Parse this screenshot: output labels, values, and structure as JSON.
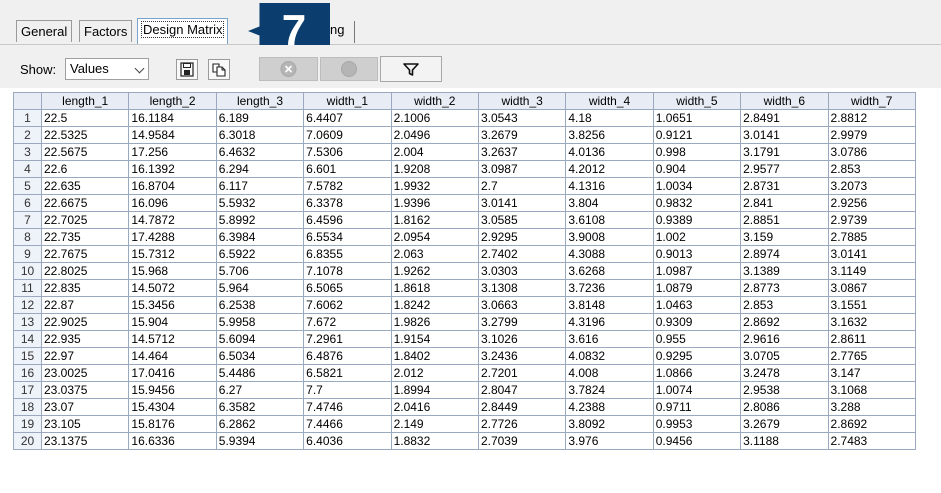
{
  "tabs": [
    {
      "label": "General",
      "active": false
    },
    {
      "label": "Factors",
      "active": false
    },
    {
      "label": "Design Matrix",
      "active": true
    }
  ],
  "tab_partial_text": "ng",
  "callout": {
    "number": "7",
    "color": "#0b3d6e"
  },
  "toolbar": {
    "show_label": "Show:",
    "show_value": "Values",
    "icons": [
      "save-icon",
      "copy-icon",
      "cancel-icon",
      "circle-icon",
      "filter-icon"
    ]
  },
  "grid": {
    "columns": [
      "length_1",
      "length_2",
      "length_3",
      "width_1",
      "width_2",
      "width_3",
      "width_4",
      "width_5",
      "width_6",
      "width_7"
    ],
    "rows": [
      [
        "1",
        "22.5",
        "16.1184",
        "6.189",
        "6.4407",
        "2.1006",
        "3.0543",
        "4.18",
        "1.0651",
        "2.8491",
        "2.8812"
      ],
      [
        "2",
        "22.5325",
        "14.9584",
        "6.3018",
        "7.0609",
        "2.0496",
        "3.2679",
        "3.8256",
        "0.9121",
        "3.0141",
        "2.9979"
      ],
      [
        "3",
        "22.5675",
        "17.256",
        "6.4632",
        "7.5306",
        "2.004",
        "3.2637",
        "4.0136",
        "0.998",
        "3.1791",
        "3.0786"
      ],
      [
        "4",
        "22.6",
        "16.1392",
        "6.294",
        "6.601",
        "1.9208",
        "3.0987",
        "4.2012",
        "0.904",
        "2.9577",
        "2.853"
      ],
      [
        "5",
        "22.635",
        "16.8704",
        "6.117",
        "7.5782",
        "1.9932",
        "2.7",
        "4.1316",
        "1.0034",
        "2.8731",
        "3.2073"
      ],
      [
        "6",
        "22.6675",
        "16.096",
        "5.5932",
        "6.3378",
        "1.9396",
        "3.0141",
        "3.804",
        "0.9832",
        "2.841",
        "2.9256"
      ],
      [
        "7",
        "22.7025",
        "14.7872",
        "5.8992",
        "6.4596",
        "1.8162",
        "3.0585",
        "3.6108",
        "0.9389",
        "2.8851",
        "2.9739"
      ],
      [
        "8",
        "22.735",
        "17.4288",
        "6.3984",
        "6.5534",
        "2.0954",
        "2.9295",
        "3.9008",
        "1.002",
        "3.159",
        "2.7885"
      ],
      [
        "9",
        "22.7675",
        "15.7312",
        "6.5922",
        "6.8355",
        "2.063",
        "2.7402",
        "4.3088",
        "0.9013",
        "2.8974",
        "3.0141"
      ],
      [
        "10",
        "22.8025",
        "15.968",
        "5.706",
        "7.1078",
        "1.9262",
        "3.0303",
        "3.6268",
        "1.0987",
        "3.1389",
        "3.1149"
      ],
      [
        "11",
        "22.835",
        "14.5072",
        "5.964",
        "6.5065",
        "1.8618",
        "3.1308",
        "3.7236",
        "1.0879",
        "2.8773",
        "3.0867"
      ],
      [
        "12",
        "22.87",
        "15.3456",
        "6.2538",
        "7.6062",
        "1.8242",
        "3.0663",
        "3.8148",
        "1.0463",
        "2.853",
        "3.1551"
      ],
      [
        "13",
        "22.9025",
        "15.904",
        "5.9958",
        "7.672",
        "1.9826",
        "3.2799",
        "4.3196",
        "0.9309",
        "2.8692",
        "3.1632"
      ],
      [
        "14",
        "22.935",
        "14.5712",
        "5.6094",
        "7.2961",
        "1.9154",
        "3.1026",
        "3.616",
        "0.955",
        "2.9616",
        "2.8611"
      ],
      [
        "15",
        "22.97",
        "14.464",
        "6.5034",
        "6.4876",
        "1.8402",
        "3.2436",
        "4.0832",
        "0.9295",
        "3.0705",
        "2.7765"
      ],
      [
        "16",
        "23.0025",
        "17.0416",
        "5.4486",
        "6.5821",
        "2.012",
        "2.7201",
        "4.008",
        "1.0866",
        "3.2478",
        "3.147"
      ],
      [
        "17",
        "23.0375",
        "15.9456",
        "6.27",
        "7.7",
        "1.8994",
        "2.8047",
        "3.7824",
        "1.0074",
        "2.9538",
        "3.1068"
      ],
      [
        "18",
        "23.07",
        "15.4304",
        "6.3582",
        "7.4746",
        "2.0416",
        "2.8449",
        "4.2388",
        "0.9711",
        "2.8086",
        "3.288"
      ],
      [
        "19",
        "23.105",
        "15.8176",
        "6.2862",
        "7.4466",
        "2.149",
        "2.7726",
        "3.8092",
        "0.9953",
        "3.2679",
        "2.8692"
      ],
      [
        "20",
        "23.1375",
        "16.6336",
        "5.9394",
        "6.4036",
        "1.8832",
        "2.7039",
        "3.976",
        "0.9456",
        "3.1188",
        "2.7483"
      ]
    ]
  }
}
